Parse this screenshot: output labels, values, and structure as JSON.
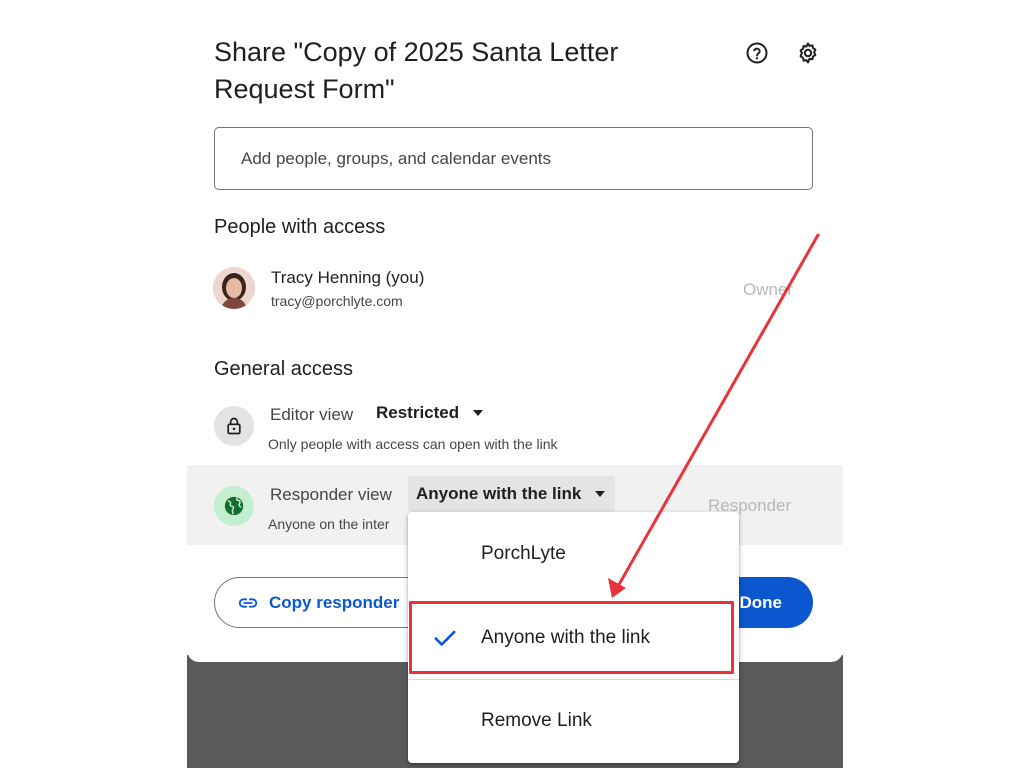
{
  "dialog": {
    "title": "Share \"Copy of 2025 Santa Letter Request Form\"",
    "help_icon": "help-circle-icon",
    "settings_icon": "gear-icon"
  },
  "add_people": {
    "placeholder": "Add people, groups, and calendar events"
  },
  "people_with_access": {
    "heading": "People with access",
    "people": [
      {
        "name": "Tracy Henning (you)",
        "email": "tracy@porchlyte.com",
        "role": "Owner"
      }
    ]
  },
  "general_access": {
    "heading": "General access",
    "editor": {
      "label": "Editor view",
      "value": "Restricted",
      "description": "Only people with access can open with the link"
    },
    "responder": {
      "label": "Responder view",
      "value": "Anyone with the link",
      "description": "Anyone on the inter",
      "role": "Responder"
    }
  },
  "footer": {
    "copy_label": "Copy responder",
    "done_label": "Done"
  },
  "dropdown_menu": {
    "items": [
      {
        "label": "PorchLyte",
        "selected": false
      },
      {
        "label": "Anyone with the link",
        "selected": true
      },
      {
        "label": "Remove Link",
        "selected": false
      }
    ]
  },
  "colors": {
    "accent_blue": "#0b57d0",
    "annotation_red": "#e8333b",
    "globe_green": "#c4eed0"
  }
}
